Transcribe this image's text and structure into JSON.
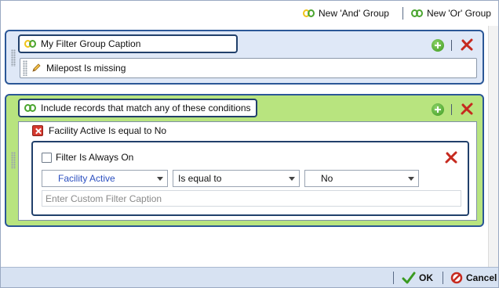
{
  "toolbar": {
    "new_and_group": "New 'And' Group",
    "new_or_group": "New 'Or' Group"
  },
  "group1": {
    "caption": "My Filter Group Caption",
    "condition": "Milepost Is missing"
  },
  "group2": {
    "caption": "Include records that match any of these conditions",
    "condition": "Facility Active Is equal to No",
    "editor": {
      "always_on_label": "Filter Is Always On",
      "field": "Facility Active",
      "operator": "Is equal to",
      "value": "No",
      "caption_placeholder": "Enter Custom Filter Caption"
    }
  },
  "footer": {
    "ok": "OK",
    "cancel": "Cancel"
  },
  "colors": {
    "and_group_bg": "#dfe8f7",
    "or_group_bg": "#b8e47f",
    "group_border": "#2b5797",
    "field_text": "#2b4fc0"
  }
}
